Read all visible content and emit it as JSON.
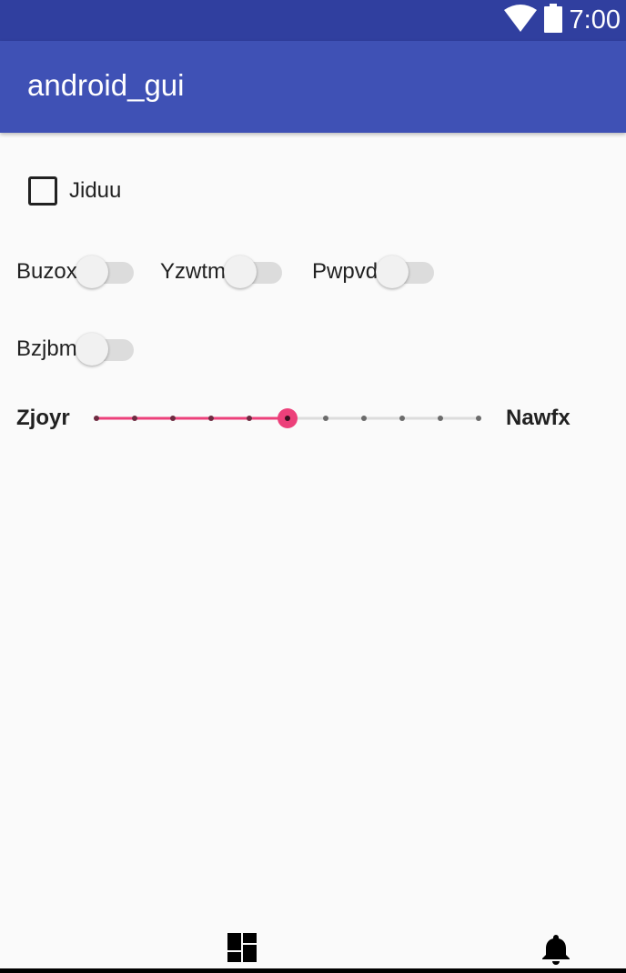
{
  "status_bar": {
    "time": "7:00",
    "icons": [
      "wifi-icon",
      "battery-icon"
    ]
  },
  "app_bar": {
    "title": "android_gui"
  },
  "checkbox": {
    "label": "Jiduu",
    "checked": false
  },
  "switches": [
    {
      "label": "Buzox",
      "on": false
    },
    {
      "label": "Yzwtm",
      "on": false
    },
    {
      "label": "Pwpvd",
      "on": false
    },
    {
      "label": "Bzjbm",
      "on": false
    }
  ],
  "slider": {
    "min_label": "Zjoyr",
    "max_label": "Nawfx",
    "steps": 10,
    "value": 5,
    "accent_color": "#ec407a"
  },
  "bottom_nav": {
    "items": [
      "dashboard-icon",
      "notifications-icon"
    ]
  },
  "colors": {
    "status_bar": "#303f9f",
    "app_bar": "#3f51b5",
    "background": "#fafafa"
  }
}
